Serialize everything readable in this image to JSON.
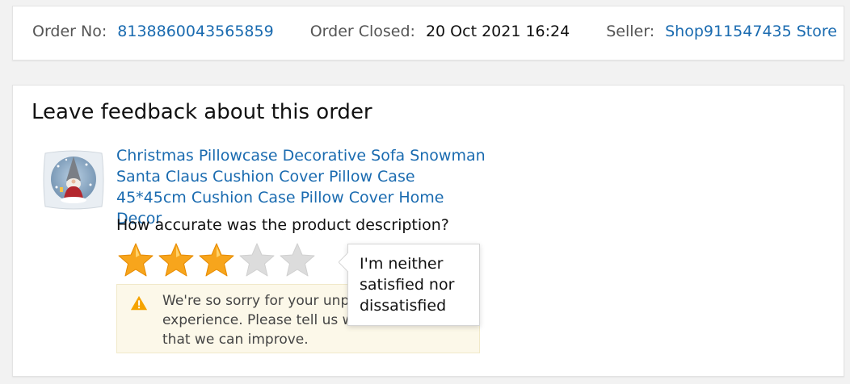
{
  "order": {
    "order_no_label": "Order No:",
    "order_no": "8138860043565859",
    "closed_label": "Order Closed:",
    "closed_value": "20 Oct 2021 16:24",
    "seller_label": "Seller:",
    "seller_name": "Shop911547435 Store"
  },
  "feedback": {
    "heading": "Leave feedback about this order",
    "product_title": "Christmas Pillowcase Decorative Sofa Snowman Santa Claus Cushion Cover Pillow Case 45*45cm Cushion Case Pillow Cover Home Decor",
    "product_image_icon": "gnome-pillow-thumbnail",
    "question": "How accurate was the product description?",
    "rating": {
      "value": 3,
      "max": 5,
      "filled_color": "#f7a51c",
      "empty_color": "#dcdcdc"
    },
    "notice_text": "We're so sorry for your unp… experience. Please tell us w… that we can improve.",
    "notice_lines": [
      "We're so sorry for your unp",
      "experience. Please tell us w",
      "that we can improve."
    ],
    "tooltip_text": "I'm neither satisfied nor dissatisfied"
  },
  "colors": {
    "link": "#1a6bb0",
    "warning": "#f5a300"
  }
}
